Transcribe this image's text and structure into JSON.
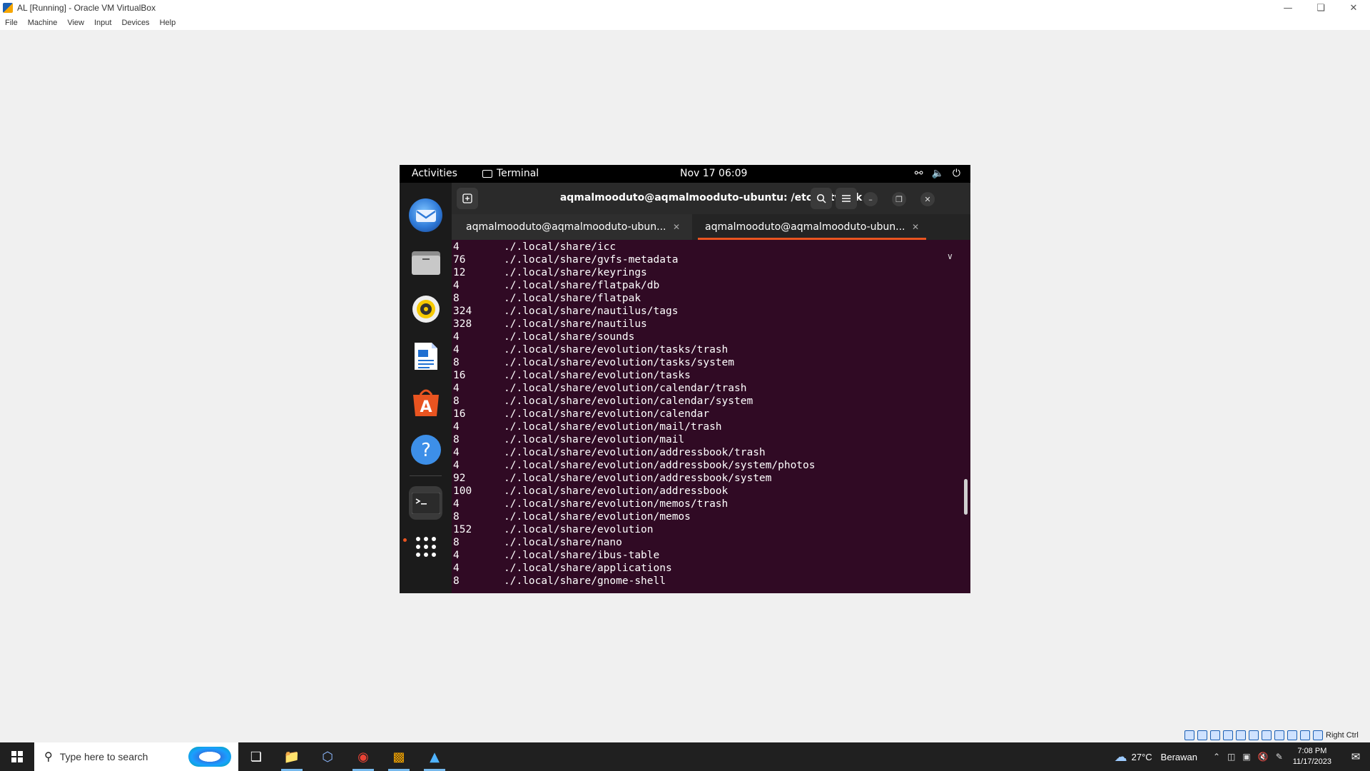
{
  "host": {
    "title": "AL [Running] - Oracle VM VirtualBox",
    "menu": [
      "File",
      "Machine",
      "View",
      "Input",
      "Devices",
      "Help"
    ],
    "host_key": "Right Ctrl"
  },
  "guest": {
    "topbar": {
      "activities": "Activities",
      "app_name": "Terminal",
      "clock": "Nov 17  06:09"
    },
    "dock": [
      "thunderbird-icon",
      "files-icon",
      "rhythmbox-icon",
      "writer-icon",
      "software-icon",
      "help-icon",
      "terminal-icon",
      "show-apps-icon"
    ],
    "terminal": {
      "title": "aqmalmooduto@aqmalmooduto-ubuntu: /etc/network",
      "tabs": [
        {
          "label": "aqmalmooduto@aqmalmooduto-ubun..."
        },
        {
          "label": "aqmalmooduto@aqmalmooduto-ubun..."
        }
      ],
      "lines": [
        {
          "size": "4",
          "path": "./.local/share/icc"
        },
        {
          "size": "76",
          "path": "./.local/share/gvfs-metadata"
        },
        {
          "size": "12",
          "path": "./.local/share/keyrings"
        },
        {
          "size": "4",
          "path": "./.local/share/flatpak/db"
        },
        {
          "size": "8",
          "path": "./.local/share/flatpak"
        },
        {
          "size": "324",
          "path": "./.local/share/nautilus/tags"
        },
        {
          "size": "328",
          "path": "./.local/share/nautilus"
        },
        {
          "size": "4",
          "path": "./.local/share/sounds"
        },
        {
          "size": "4",
          "path": "./.local/share/evolution/tasks/trash"
        },
        {
          "size": "8",
          "path": "./.local/share/evolution/tasks/system"
        },
        {
          "size": "16",
          "path": "./.local/share/evolution/tasks"
        },
        {
          "size": "4",
          "path": "./.local/share/evolution/calendar/trash"
        },
        {
          "size": "8",
          "path": "./.local/share/evolution/calendar/system"
        },
        {
          "size": "16",
          "path": "./.local/share/evolution/calendar"
        },
        {
          "size": "4",
          "path": "./.local/share/evolution/mail/trash"
        },
        {
          "size": "8",
          "path": "./.local/share/evolution/mail"
        },
        {
          "size": "4",
          "path": "./.local/share/evolution/addressbook/trash"
        },
        {
          "size": "4",
          "path": "./.local/share/evolution/addressbook/system/photos"
        },
        {
          "size": "92",
          "path": "./.local/share/evolution/addressbook/system"
        },
        {
          "size": "100",
          "path": "./.local/share/evolution/addressbook"
        },
        {
          "size": "4",
          "path": "./.local/share/evolution/memos/trash"
        },
        {
          "size": "8",
          "path": "./.local/share/evolution/memos"
        },
        {
          "size": "152",
          "path": "./.local/share/evolution"
        },
        {
          "size": "8",
          "path": "./.local/share/nano"
        },
        {
          "size": "4",
          "path": "./.local/share/ibus-table"
        },
        {
          "size": "4",
          "path": "./.local/share/applications"
        },
        {
          "size": "8",
          "path": "./.local/share/gnome-shell"
        }
      ]
    }
  },
  "taskbar": {
    "search_placeholder": "Type here to search",
    "weather_temp": "27°C",
    "weather_desc": "Berawan",
    "time": "7:08 PM",
    "date": "11/17/2023"
  },
  "colors": {
    "terminal_bg": "#300a24",
    "accent": "#e95420",
    "dock_bg": "#1b1b1b"
  }
}
